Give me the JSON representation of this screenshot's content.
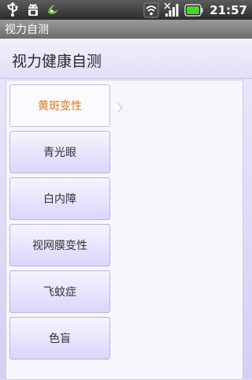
{
  "status_bar": {
    "time": "21:57",
    "left_icons": [
      "usb-icon",
      "android-debug-icon",
      "app-notification-icon"
    ],
    "right_icons": [
      "wifi-icon",
      "signal-icon",
      "battery-icon"
    ]
  },
  "app": {
    "title": "视力自测"
  },
  "page": {
    "header": "视力健康自测"
  },
  "menu": {
    "items": [
      {
        "label": "黄斑变性",
        "selected": true
      },
      {
        "label": "青光眼",
        "selected": false
      },
      {
        "label": "白内障",
        "selected": false
      },
      {
        "label": "视网膜变性",
        "selected": false
      },
      {
        "label": "飞蚊症",
        "selected": false
      },
      {
        "label": "色盲",
        "selected": false
      }
    ]
  },
  "colors": {
    "selected_text": "#e07818",
    "background": "#dcd6f4",
    "battery": "#4cd133"
  }
}
